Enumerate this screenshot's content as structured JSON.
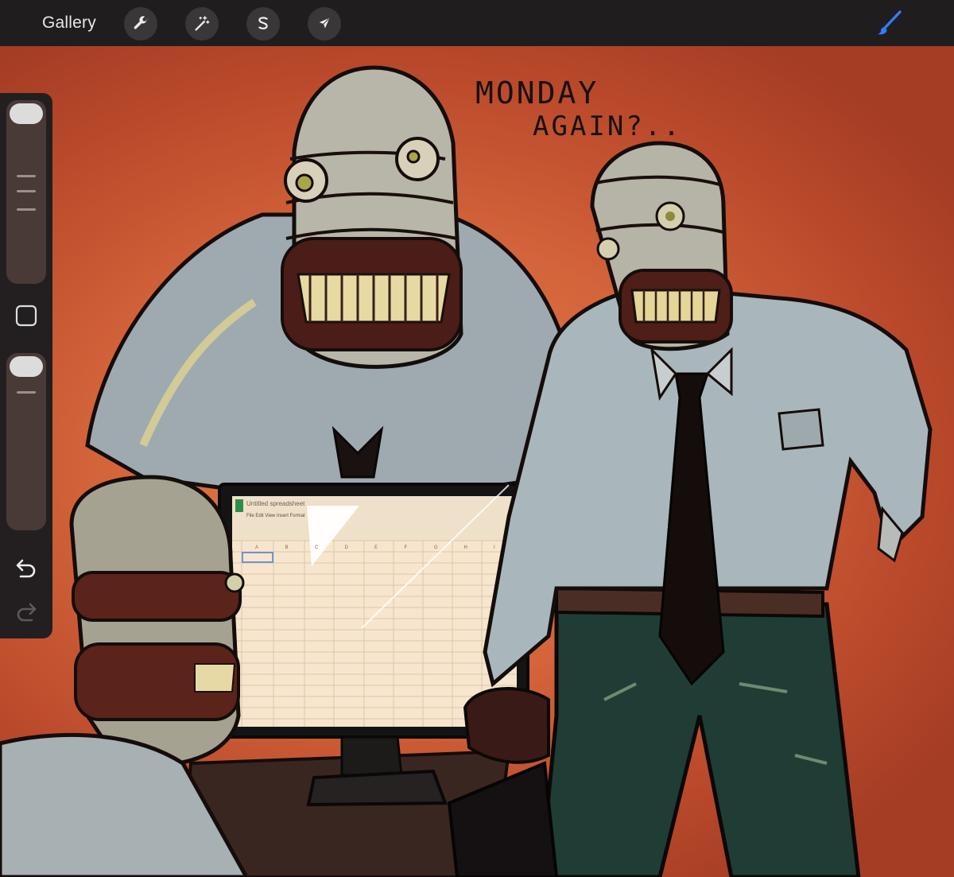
{
  "toolbar": {
    "gallery_label": "Gallery",
    "tools": [
      {
        "name": "wrench-icon",
        "label": "Actions"
      },
      {
        "name": "magic-wand-icon",
        "label": "Adjustments"
      },
      {
        "name": "selection-s-icon",
        "label": "Selection"
      },
      {
        "name": "arrow-cursor-icon",
        "label": "Transform"
      }
    ],
    "brush": {
      "icon": "brush-icon",
      "color": "#2f7dfd"
    }
  },
  "sidebar": {
    "brush_size_level": 0.0,
    "brush_opacity_level": 0.0,
    "modifier_icon": "square-modifier-icon",
    "undo_icon": "undo-icon",
    "redo_icon": "redo-icon",
    "redo_enabled": false
  },
  "artwork": {
    "caption_line1": "MONDAY",
    "caption_line2": "AGAIN?..",
    "spreadsheet_title": "Untitled spreadsheet",
    "spreadsheet_menu": [
      "File",
      "Edit",
      "View",
      "Insert",
      "Format"
    ],
    "spreadsheet_columns": [
      "A",
      "B",
      "C",
      "D",
      "E",
      "F",
      "G",
      "H",
      "I"
    ],
    "background_color": "#d4643a"
  }
}
